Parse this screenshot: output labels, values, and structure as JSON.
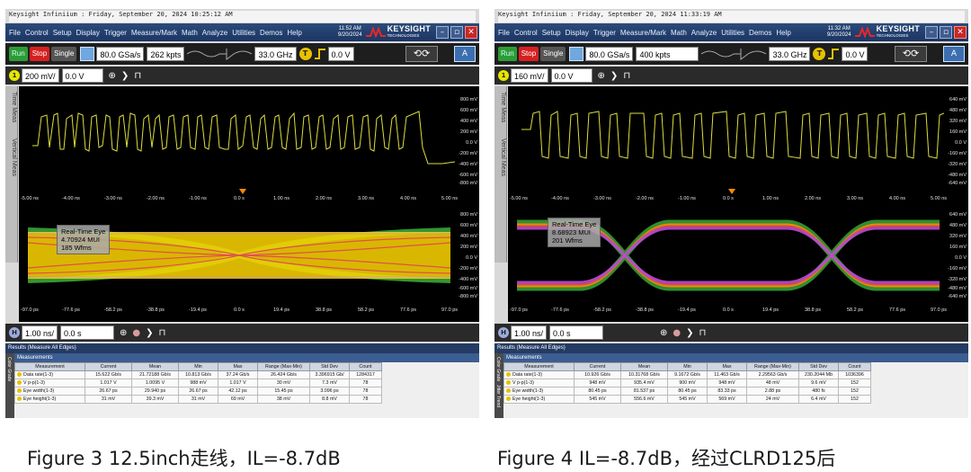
{
  "colors": {
    "trace": "#dede3a",
    "eye_hot": "#ffd700",
    "eye_mid": "#e05050",
    "eye_cool": "#3aa63a",
    "menu_bg": "#1c3563",
    "run": "#2e9b36",
    "stop": "#d62020"
  },
  "panels": [
    {
      "title": "Keysight Infiniium : Friday, September 20, 2024 10:25:12 AM",
      "menu": [
        "File",
        "Control",
        "Setup",
        "Display",
        "Trigger",
        "Measure/Mark",
        "Math",
        "Analyze",
        "Utilities",
        "Demos",
        "Help"
      ],
      "clock_time": "11:52 AM",
      "clock_date": "9/20/2024",
      "brand": "KEYSIGHT",
      "brand_sub": "TECHNOLOGIES",
      "run": "Run",
      "stop": "Stop",
      "single": "Single",
      "sample_rate": "80.0 GSa/s",
      "memory": "262 kpts",
      "bandwidth": "33.0 GHz",
      "trigger_level": "0.0 V",
      "ch_scale": "200 mV/",
      "ch_offset": "0.0 V",
      "y_labels": [
        "800 mV",
        "600 mV",
        "400 mV",
        "200 mV",
        "0.0 V",
        "-200 mV",
        "-400 mV",
        "-600 mV",
        "-800 mV"
      ],
      "x_labels_top": [
        "-5.00 ns",
        "-4.00 ns",
        "-3.00 ns",
        "-2.00 ns",
        "-1.00 ns",
        "0.0 s",
        "1.00 ns",
        "2.00 ns",
        "3.00 ns",
        "4.00 ns",
        "5.00 ns"
      ],
      "eye_y_labels": [
        "800 mV",
        "600 mV",
        "400 mV",
        "200 mV",
        "0.0 V",
        "-200 mV",
        "-400 mV",
        "-600 mV",
        "-800 mV"
      ],
      "x_labels_eye": [
        "-97.0 ps",
        "-77.6 ps",
        "-58.2 ps",
        "-38.8 ps",
        "-19.4 ps",
        "0.0 s",
        "19.4 ps",
        "38.8 ps",
        "58.2 ps",
        "77.6 ps",
        "97.0 ps"
      ],
      "eye_label": [
        "Real-Time Eye",
        "4.70924 MUI",
        "185 Wfms"
      ],
      "h_scale": "1.00 ns/",
      "h_pos": "0.0 s",
      "results_title": "Results (Measure All Edges)",
      "measurements_title": "Measurements",
      "columns": [
        "Measurement",
        "Current",
        "Mean",
        "Min",
        "Max",
        "Range (Max-Min)",
        "Std Dev",
        "Count"
      ],
      "rows": [
        [
          "Data rate(1-3)",
          "15.622 Gb/s",
          "21.72188 Gb/s",
          "10.813 Gb/s",
          "37.24 Gb/s",
          "26.424 Gb/s",
          "3.396915 Gb/",
          "1284317"
        ],
        [
          "V p-p(1-3)",
          "1.017 V",
          "1.0095 V",
          "988 mV",
          "1.017 V",
          "30 mV",
          "7.3 mV",
          "78"
        ],
        [
          "Eye width(1-3)",
          "26.67 ps",
          "29.940 ps",
          "26.67 ps",
          "42.12 ps",
          "15.45 ps",
          "3.096 ps",
          "78"
        ],
        [
          "Eye height(1-3)",
          "31 mV",
          "39.3 mV",
          "31 mV",
          "69 mV",
          "38 mV",
          "8.8 mV",
          "78"
        ]
      ],
      "side_tabs": [
        "Time Meas",
        "Vertical Meas"
      ],
      "result_side": [
        "Color Grade"
      ],
      "caption": "Figure 3 12.5inch走线，IL=-8.7dB"
    },
    {
      "title": "Keysight Infiniium : Friday, September 20, 2024 11:33:19 AM",
      "menu": [
        "File",
        "Control",
        "Setup",
        "Display",
        "Trigger",
        "Measure/Mark",
        "Math",
        "Analyze",
        "Utilities",
        "Demos",
        "Help"
      ],
      "clock_time": "11:32 AM",
      "clock_date": "9/20/2024",
      "brand": "KEYSIGHT",
      "brand_sub": "TECHNOLOGIES",
      "run": "Run",
      "stop": "Stop",
      "single": "Single",
      "sample_rate": "80.0 GSa/s",
      "memory": "400 kpts",
      "bandwidth": "33.0 GHz",
      "trigger_level": "0.0 V",
      "ch_scale": "160 mV/",
      "ch_offset": "0.0 V",
      "y_labels": [
        "640 mV",
        "480 mV",
        "320 mV",
        "160 mV",
        "0.0 V",
        "-160 mV",
        "-320 mV",
        "-480 mV",
        "-640 mV"
      ],
      "x_labels_top": [
        "-5.00 ns",
        "-4.00 ns",
        "-3.00 ns",
        "-2.00 ns",
        "-1.00 ns",
        "0.0 s",
        "1.00 ns",
        "2.00 ns",
        "3.00 ns",
        "4.00 ns",
        "5.00 ns"
      ],
      "eye_y_labels": [
        "640 mV",
        "480 mV",
        "320 mV",
        "160 mV",
        "0.0 V",
        "-160 mV",
        "-320 mV",
        "-480 mV",
        "-640 mV"
      ],
      "x_labels_eye": [
        "-97.0 ps",
        "-77.6 ps",
        "-58.2 ps",
        "-38.8 ps",
        "-19.4 ps",
        "0.0 s",
        "19.4 ps",
        "38.8 ps",
        "58.2 ps",
        "77.6 ps",
        "97.0 ps"
      ],
      "eye_label": [
        "Real-Time Eye",
        "8.68923 MUI",
        "201 Wfms"
      ],
      "h_scale": "1.00 ns/",
      "h_pos": "0.0 s",
      "results_title": "Results (Measure All Edges)",
      "measurements_title": "Measurements",
      "columns": [
        "Measurement",
        "Current",
        "Mean",
        "Min",
        "Max",
        "Range (Max-Min)",
        "Std Dev",
        "Count"
      ],
      "rows": [
        [
          "Data rate(1-3)",
          "10.926 Gb/s",
          "10.31768 Gb/s",
          "9.1672 Gb/s",
          "11.463 Gb/s",
          "2.29563 Gb/s",
          "230.2044 Mb",
          "1036396"
        ],
        [
          "V p-p(1-3)",
          "948 mV",
          "935.4 mV",
          "900 mV",
          "948 mV",
          "48 mV",
          "9.6 mV",
          "152"
        ],
        [
          "Eye width(1-3)",
          "80.45 ps",
          "81.537 ps",
          "80.45 ps",
          "83.33 ps",
          "2.88 ps",
          "480 fs",
          "152"
        ],
        [
          "Eye height(1-3)",
          "545 mV",
          "556.6 mV",
          "545 mV",
          "569 mV",
          "24 mV",
          "6.4 mV",
          "152"
        ]
      ],
      "side_tabs": [
        "Time Meas",
        "Vertical Meas"
      ],
      "result_side": [
        "Color Grade",
        "Jitter Trend"
      ],
      "caption": "Figure 4 IL=-8.7dB，经过CLRD125后"
    }
  ]
}
